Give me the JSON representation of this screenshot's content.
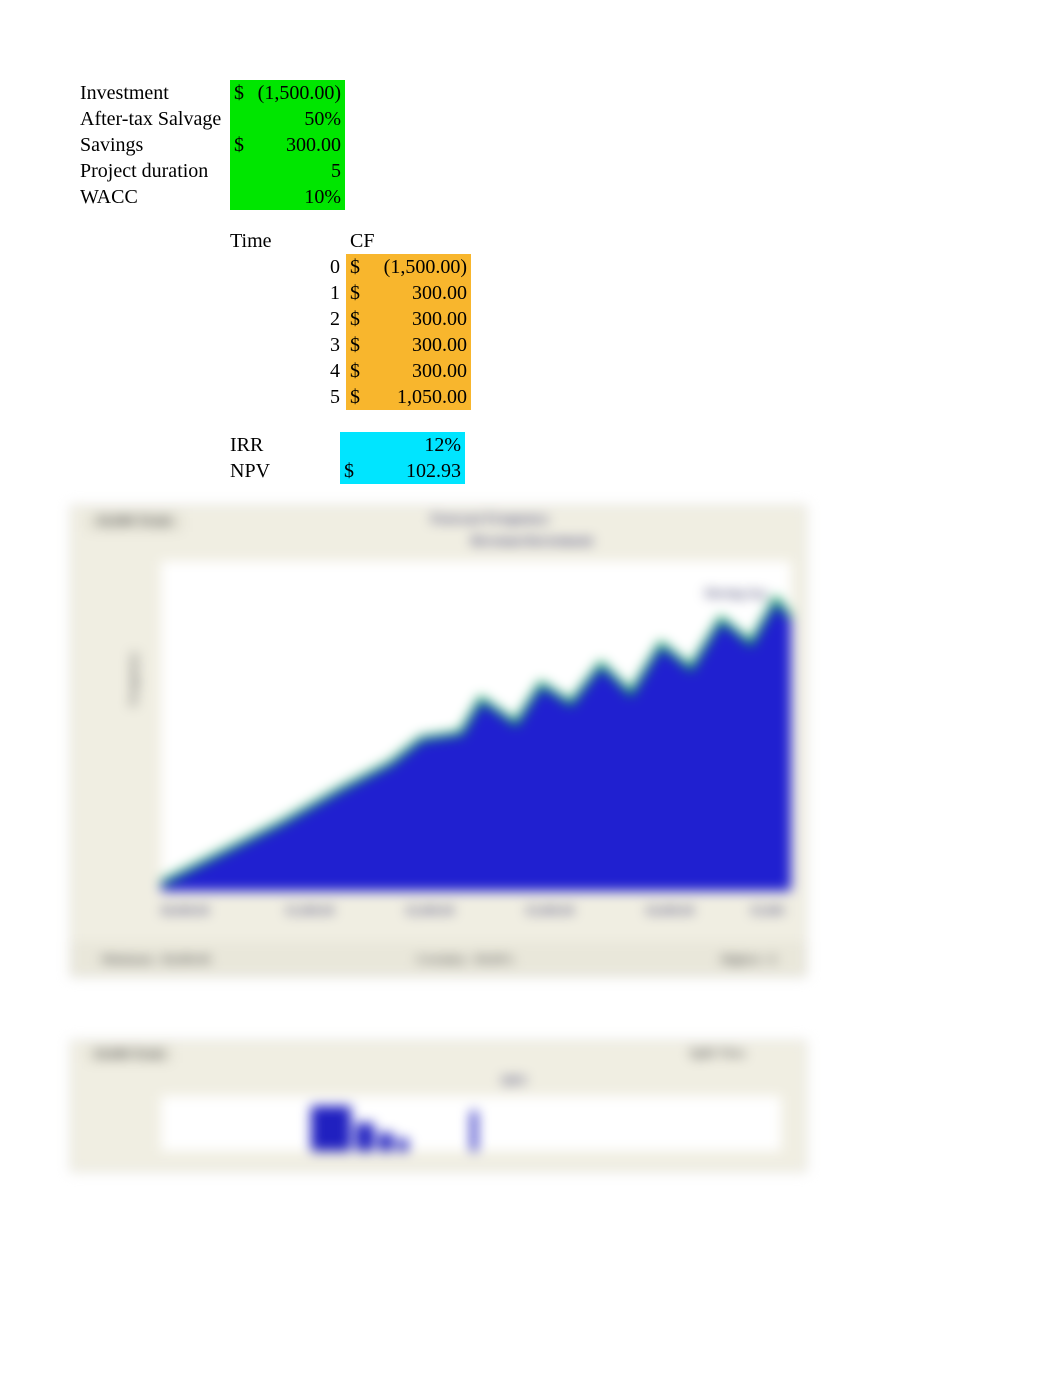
{
  "inputs": {
    "investment": {
      "label": "Investment",
      "currency": "$",
      "value": "(1,500.00)"
    },
    "after_tax_salvage": {
      "label": "After-tax Salvage",
      "currency": "",
      "value": "50%"
    },
    "savings": {
      "label": "Savings",
      "currency": "$",
      "value": "300.00"
    },
    "project_duration": {
      "label": "Project duration",
      "currency": "",
      "value": "5"
    },
    "wacc": {
      "label": "WACC",
      "currency": "",
      "value": "10%"
    }
  },
  "cf_table": {
    "headers": {
      "time": "Time",
      "cf": "CF"
    },
    "rows": [
      {
        "time": "0",
        "currency": "$",
        "value": "(1,500.00)"
      },
      {
        "time": "1",
        "currency": "$",
        "value": "300.00"
      },
      {
        "time": "2",
        "currency": "$",
        "value": "300.00"
      },
      {
        "time": "3",
        "currency": "$",
        "value": "300.00"
      },
      {
        "time": "4",
        "currency": "$",
        "value": "300.00"
      },
      {
        "time": "5",
        "currency": "$",
        "value": "1,050.00"
      }
    ]
  },
  "results": {
    "irr": {
      "label": "IRR",
      "currency": "",
      "value": "12%"
    },
    "npv": {
      "label": "NPV",
      "currency": "$",
      "value": "102.93"
    }
  },
  "chart_data": [
    {
      "type": "area",
      "title": "Forecast Frequency",
      "ylabel": "Frequency",
      "note": "area chart — details obscured/blurred in source"
    },
    {
      "type": "bar",
      "title": "NPV",
      "note": "small histogram — details obscured/blurred in source"
    }
  ]
}
